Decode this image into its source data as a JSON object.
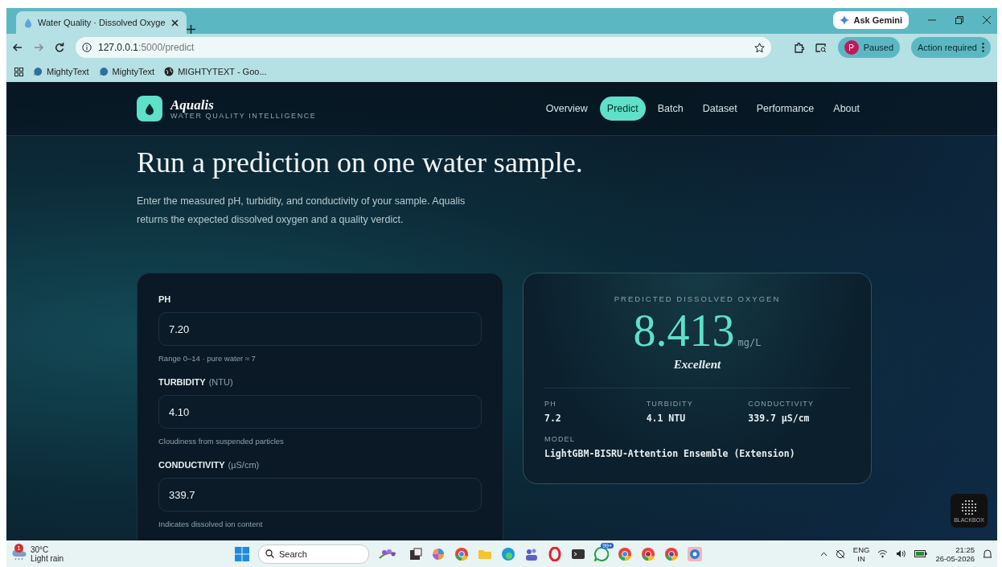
{
  "browser": {
    "tab_title": "Water Quality · Dissolved Oxyge",
    "url_host": "127.0.0.1",
    "url_path": ":5000/predict",
    "bookmarks": [
      "MightyText",
      "MightyText",
      "MIGHTYTEXT - Goo..."
    ],
    "gemini": "Ask Gemini",
    "profile_initial": "P",
    "profile_status": "Paused",
    "action": "Action required"
  },
  "brand": {
    "name": "Aqualis",
    "tagline": "WATER QUALITY INTELLIGENCE"
  },
  "nav": [
    {
      "label": "Overview",
      "selected": false
    },
    {
      "label": "Predict",
      "selected": true
    },
    {
      "label": "Batch",
      "selected": false
    },
    {
      "label": "Dataset",
      "selected": false
    },
    {
      "label": "Performance",
      "selected": false
    },
    {
      "label": "About",
      "selected": false
    }
  ],
  "heading": "Run a prediction on one water sample.",
  "intro": "Enter the measured pH, turbidity, and conductivity of your sample. Aqualis returns the expected dissolved oxygen and a quality verdict.",
  "fields": [
    {
      "name": "PH",
      "value": "7.20",
      "hint": "Range 0–14 · pure water ≈ 7"
    },
    {
      "name": "TURBIDITY",
      "unit": "(NTU)",
      "value": "4.10",
      "hint": "Cloudiness from suspended particles"
    },
    {
      "name": "CONDUCTIVITY",
      "unit": "(µS/cm)",
      "value": "339.7",
      "hint": "Indicates dissolved ion content"
    }
  ],
  "result": {
    "kicker": "PREDICTED DISSOLVED OXYGEN",
    "value": "8.413",
    "unit": "mg/L",
    "verdict": "Excellent",
    "stats": [
      {
        "label": "PH",
        "value": "7.2"
      },
      {
        "label": "TURBIDITY",
        "value": "4.1 NTU"
      },
      {
        "label": "CONDUCTIVITY",
        "value": "339.7 µS/cm"
      }
    ],
    "model_label": "MODEL",
    "model": "LightGBM-BISRU-Attention Ensemble (Extension)"
  },
  "floating_badge": "BLACKBOX",
  "taskbar": {
    "weather_alert": "1",
    "temperature": "30°C",
    "weather": "Light rain",
    "search": "Search",
    "chat_badge": "99+",
    "lang": "ENG",
    "region": "IN",
    "time": "21:25",
    "date": "26-05-2026"
  }
}
